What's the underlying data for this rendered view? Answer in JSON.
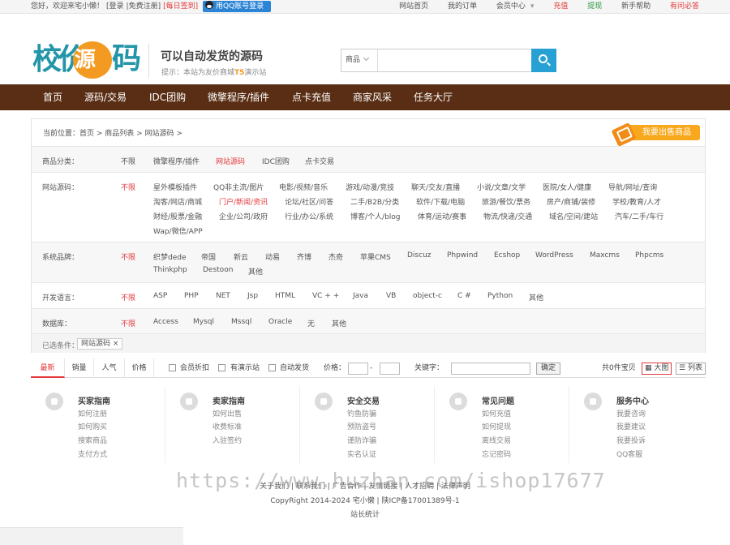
{
  "topbar": {
    "welcome": "您好，欢迎来宅小懒！",
    "login": "[登录",
    "register": "|免费注册]",
    "sign": "[每日签到]",
    "qq_login": "用QQ账号登录",
    "links": [
      "网站首页",
      "我的订单",
      "会员中心",
      "充值",
      "提现",
      "新手帮助",
      "有问必答"
    ]
  },
  "header": {
    "logo_a": "校价",
    "logo_b": "源",
    "logo_c": "码",
    "slogan": "可以自动发货的源码",
    "tip_prefix": "提示：本站为友价商城",
    "tip_brand": "T5",
    "tip_suffix": "演示站",
    "search_type": "商品",
    "search_placeholder": ""
  },
  "nav": [
    "首页",
    "源码/交易",
    "IDC团购",
    "微擎程序/插件",
    "点卡充值",
    "商家风采",
    "任务大厅"
  ],
  "filter": {
    "crumb": "当前位置：首页 > 商品列表 > 网站源码 >",
    "sell_button": "我要出售商品",
    "rows": {
      "category": {
        "label": "商品分类：",
        "items": [
          "不限",
          "微擎程序/插件",
          "网站源码",
          "IDC团购",
          "点卡交易"
        ]
      },
      "site": {
        "label": "网站源码：",
        "items": [
          "不限",
          "星外模板插件",
          "QQ非主流/图片",
          "电影/视频/音乐",
          "游戏/动漫/竞技",
          "聊天/交友/直播",
          "小说/文章/文学",
          "医院/女人/健康",
          "导航/网址/查询",
          "淘客/网店/商城",
          "门户/新闻/资讯",
          "论坛/社区/问答",
          "二手/B2B/分类",
          "软件/下载/电脑",
          "旅游/餐饮/票务",
          "房产/商铺/装修",
          "学校/教育/人才",
          "财经/股票/金融",
          "企业/公司/政府",
          "行业/办公/系统",
          "博客/个人/blog",
          "体育/运动/赛事",
          "物流/快递/交通",
          "域名/空间/建站",
          "汽车/二手/车行",
          "Wap/微信/APP"
        ]
      },
      "brand": {
        "label": "系统品牌：",
        "items": [
          "不限",
          "织梦dede",
          "帝国",
          "新云",
          "动易",
          "齐博",
          "杰奇",
          "苹果CMS",
          "Discuz",
          "Phpwind",
          "Ecshop",
          "WordPress",
          "Maxcms",
          "Phpcms",
          "Thinkphp",
          "Destoon",
          "其他"
        ]
      },
      "lang": {
        "label": "开发语言：",
        "items": [
          "不限",
          "ASP",
          "PHP",
          "NET",
          "Jsp",
          "HTML",
          "VC + +",
          "Java",
          "VB",
          "object-c",
          "C #",
          "Python",
          "其他"
        ]
      },
      "db": {
        "label": "数据库：",
        "items": [
          "不限",
          "Access",
          "Mysql",
          "Mssql",
          "Oracle",
          "无",
          "其他"
        ]
      }
    },
    "chosen_label": "已选条件：",
    "chosen_tag": "网站源码 ×"
  },
  "sortbar": {
    "tabs": [
      "最新",
      "销量",
      "人气",
      "价格"
    ],
    "checks": [
      "会员折扣",
      "有演示站",
      "自动发货"
    ],
    "price_label": "价格：",
    "dash": "-",
    "keyword_label": "关键字：",
    "confirm": "确定",
    "total": "共0件宝贝",
    "view_big": "大图",
    "view_list": "列表"
  },
  "footer": {
    "cols": [
      {
        "title": "买家指南",
        "links": [
          "如何注册",
          "如何购买",
          "搜索商品",
          "支付方式"
        ]
      },
      {
        "title": "卖家指南",
        "links": [
          "如何出售",
          "收费标准",
          "入驻签约"
        ]
      },
      {
        "title": "安全交易",
        "links": [
          "钓鱼防骗",
          "预防盗号",
          "谨防诈骗",
          "实名认证"
        ]
      },
      {
        "title": "常见问题",
        "links": [
          "如何充值",
          "如何提现",
          "离线交易",
          "忘记密码"
        ]
      },
      {
        "title": "服务中心",
        "links": [
          "我要咨询",
          "我要建议",
          "我要投诉",
          "QQ客服"
        ]
      }
    ],
    "links_line": "关于我们 | 联系我们 | 广告合作 | 友情链接 | 人才招聘 | 法律声明",
    "copyright": "CopyRight 2014-2024 宅小懒 | 陕ICP备17001389号-1",
    "stats": "站长统计",
    "watermark": "https://www.huzhan.com/ishop17677"
  },
  "colors": {
    "nav_bg": "#5a2e14",
    "accent_red": "#e4393c",
    "brand_blue": "#2296a8",
    "brand_orange": "#f39a22"
  }
}
